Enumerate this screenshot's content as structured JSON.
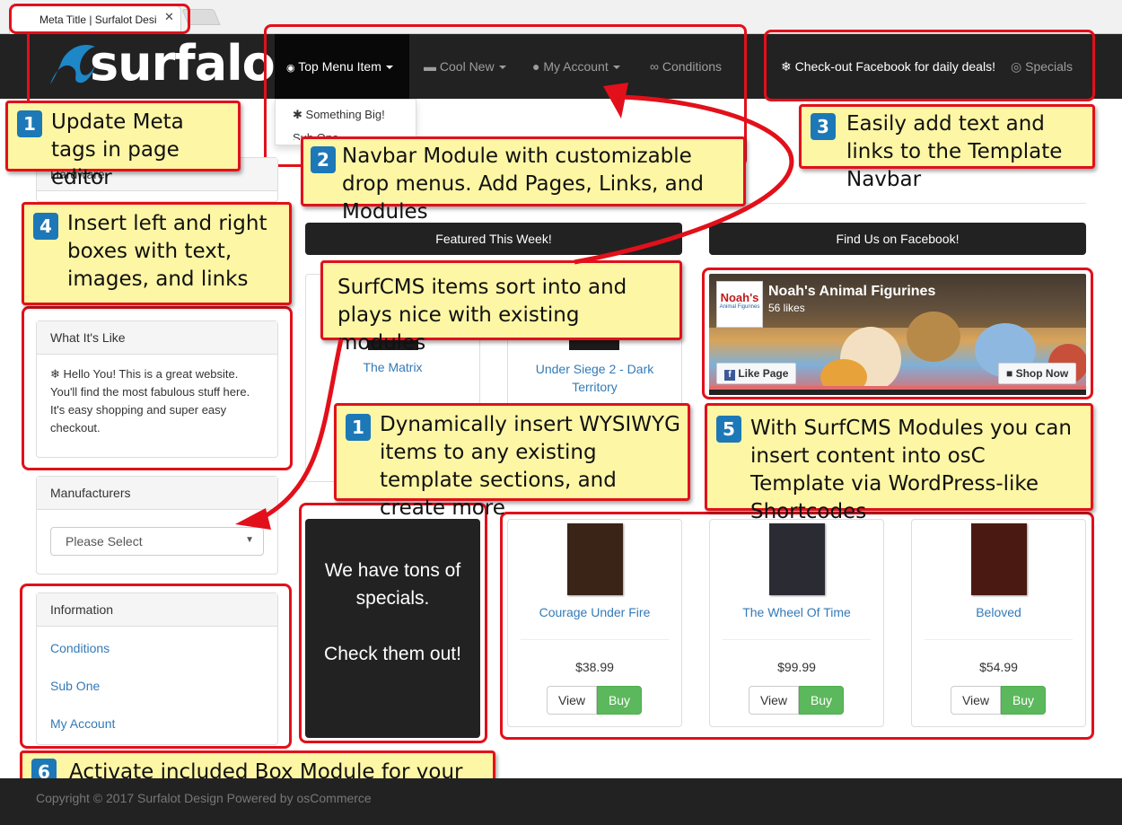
{
  "browser": {
    "tab_title": "Meta Title | Surfalot Desi",
    "close_glyph": "✕"
  },
  "logo": {
    "text": "surfalot"
  },
  "navbar": {
    "items": [
      {
        "label": "Top Menu Item",
        "icon": "rss-icon"
      },
      {
        "label": "Cool New",
        "icon": "bath-icon"
      },
      {
        "label": "My Account",
        "icon": "user-icon"
      },
      {
        "label": "Conditions",
        "icon": "handshake-icon"
      }
    ],
    "right_text": "❄ Check-out Facebook for daily deals!",
    "specials": "Specials",
    "dropdown": [
      {
        "label": "Something Big!",
        "icon": "bug-icon"
      },
      {
        "label": "Sub One"
      }
    ]
  },
  "callouts": {
    "c1": {
      "num": "1",
      "text": "Update Meta tags in page editor"
    },
    "c2": {
      "num": "2",
      "text": "Navbar Module with customizable drop menus. Add Pages, Links, and Modules"
    },
    "c3": {
      "num": "3",
      "text": "Easily add text and links to the Template Navbar"
    },
    "c4": {
      "num": "4",
      "text": "Insert left and right boxes with text, images, and links"
    },
    "surf": {
      "text": "SurfCMS items sort into and plays nice with existing modules"
    },
    "c1b": {
      "num": "1",
      "text": "Dynamically insert WYSIWYG items to any existing template sections, and create more"
    },
    "c5": {
      "num": "5",
      "text": "With SurfCMS Modules you can insert content into osC Template via WordPress-like Shortcodes"
    },
    "c6": {
      "num": "6",
      "text": "Activate included Box Module for your pages"
    }
  },
  "left": {
    "hardware_heading": "Hardware",
    "what_its_like": {
      "heading": "What It's Like",
      "body": "❄ Hello You! This is a great website. You'll find the most fabulous stuff here. It's easy shopping and super easy checkout."
    },
    "manufacturers": {
      "heading": "Manufacturers",
      "placeholder": "Please Select"
    },
    "information": {
      "heading": "Information",
      "links": [
        "Conditions",
        "Sub One",
        "My Account"
      ]
    }
  },
  "featured": {
    "title": "Featured This Week!",
    "items": [
      {
        "title": "The Matrix"
      },
      {
        "title": "Under Siege 2 - Dark Territory"
      }
    ]
  },
  "facebook": {
    "title": "Find Us on Facebook!",
    "page_name": "Noah's Animal Figurines",
    "likes": "56 likes",
    "like_button": "Like Page",
    "shop_button": "Shop Now",
    "logo_text": "Noah's",
    "logo_sub": "Animal Figurines"
  },
  "specials_box": {
    "text": "We have tons of specials.\n\nCheck them out!"
  },
  "products": [
    {
      "title": "Courage Under Fire",
      "price": "$38.99",
      "view": "View",
      "buy": "Buy",
      "cover_color": "#3a2418"
    },
    {
      "title": "The Wheel Of Time",
      "price": "$99.99",
      "view": "View",
      "buy": "Buy",
      "cover_color": "#2b2b33"
    },
    {
      "title": "Beloved",
      "price": "$54.99",
      "view": "View",
      "buy": "Buy",
      "cover_color": "#4a1a12"
    }
  ],
  "footer": {
    "text": "Copyright © 2017 Surfalot Design Powered by osCommerce"
  },
  "colors": {
    "callout_bg": "#fdf6a4",
    "callout_border": "#e2101a",
    "badge": "#1d78b7",
    "navbar": "#222222",
    "link": "#337ab7",
    "buy": "#5cb85c"
  }
}
